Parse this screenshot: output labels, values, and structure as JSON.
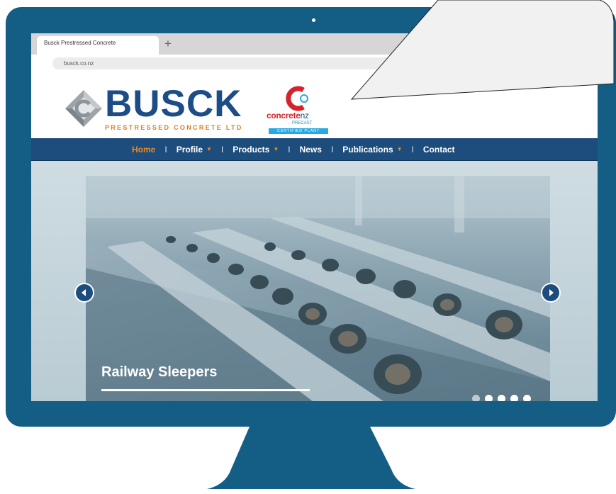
{
  "browser": {
    "tab_title": "Busck Prestressed Concrete",
    "new_tab_glyph": "+",
    "url": "busck.co.nz"
  },
  "logo": {
    "name": "BUSCK",
    "tagline": "PRESTRESSED CONCRETE LTD"
  },
  "badge": {
    "word_main": "concrete",
    "word_suffix": "nz",
    "sub": "PRECAST",
    "cert": "CERTIFIED PLANT"
  },
  "nav": {
    "items": [
      {
        "label": "Home",
        "active": true,
        "dropdown": false
      },
      {
        "label": "Profile",
        "active": false,
        "dropdown": true
      },
      {
        "label": "Products",
        "active": false,
        "dropdown": true
      },
      {
        "label": "News",
        "active": false,
        "dropdown": false
      },
      {
        "label": "Publications",
        "active": false,
        "dropdown": true
      },
      {
        "label": "Contact",
        "active": false,
        "dropdown": false
      }
    ],
    "separator": "I",
    "caret": "▼"
  },
  "slider": {
    "title": "Railway Sleepers",
    "slide_count": 5,
    "active_slide": 1,
    "prev_icon": "arrow-left-icon",
    "next_icon": "arrow-right-icon"
  },
  "colors": {
    "monitor": "#145e86",
    "brand_blue": "#1d4d86",
    "nav_bg": "#1c4d7c",
    "accent_orange": "#f08a1e",
    "badge_red": "#d6232b"
  }
}
